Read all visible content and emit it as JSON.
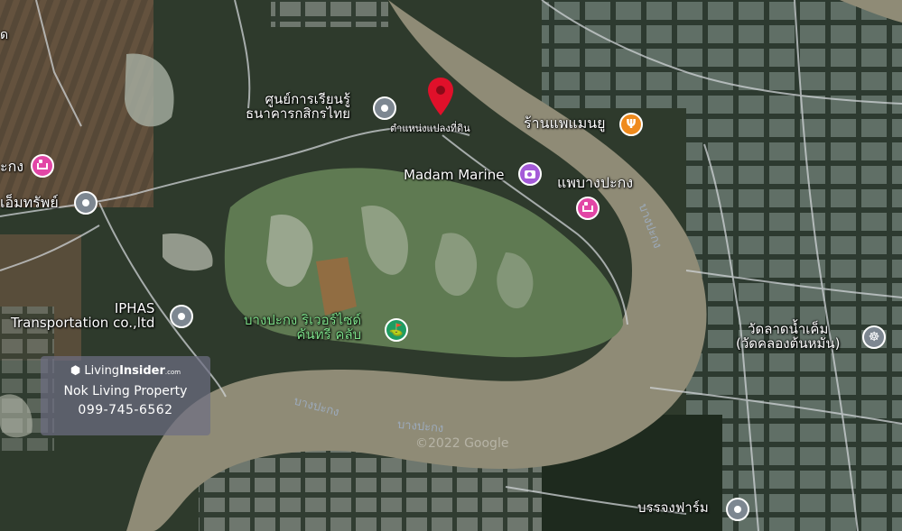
{
  "map": {
    "places": [
      {
        "id": "learning-center",
        "label": "ศูนย์การเรียนรู้\nธนาคารกสิกรไทย",
        "pin": "grey"
      },
      {
        "id": "marker",
        "label": "ตำแหน่งแปลงที่ดิน",
        "pin": "red-marker"
      },
      {
        "id": "restaurant",
        "label": "ร้านแพแมนยู",
        "pin": "orange-restaurant"
      },
      {
        "id": "madam-marine",
        "label": "Madam Marine",
        "pin": "purple-camera"
      },
      {
        "id": "pae-bangpakong",
        "label": "แพบางปะกง",
        "pin": "pink-hotel"
      },
      {
        "id": "hotel-left",
        "label": "ะกง",
        "pin": "pink-hotel"
      },
      {
        "id": "emsap",
        "label": "เอ็มทรัพย์",
        "pin": "grey"
      },
      {
        "id": "iphas",
        "label": "IPHAS\nTransportation co.,ltd",
        "pin": "grey"
      },
      {
        "id": "golf",
        "label": "บางปะกง ริเวอร์ไซด์\nคันทรี คลับ",
        "pin": "green-golf"
      },
      {
        "id": "temple",
        "label": "วัดลาดน้ำเค็ม\n(วัดคลองต้นหมัน)",
        "pin": "grey-temple"
      },
      {
        "id": "farm",
        "label": "บรรจงฟาร์ม",
        "pin": "grey"
      },
      {
        "id": "corner",
        "label": "ด",
        "pin": ""
      }
    ],
    "river_labels": [
      "บางปะกง",
      "บางปะกง",
      "บางปะกง"
    ],
    "watermark": "©2022 Google"
  },
  "brand": {
    "logo_living": "Living",
    "logo_insider": "Insider",
    "logo_com": ".com",
    "agent": "Nok Living Property",
    "phone": "099-745-6562"
  },
  "colors": {
    "marker": "#e0102a",
    "river": "#8f8b76",
    "golf": "#5f7a52"
  }
}
